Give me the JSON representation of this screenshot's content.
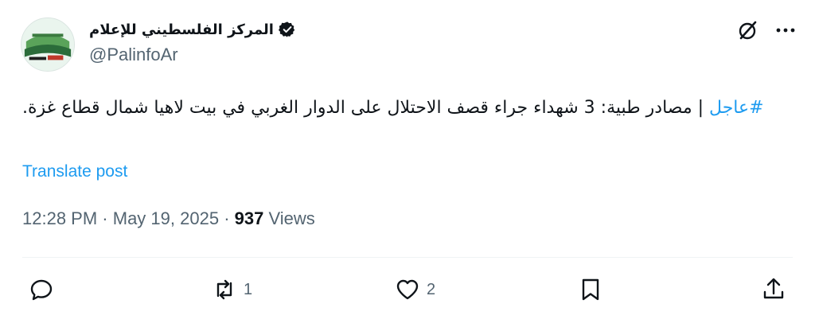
{
  "author": {
    "display_name": "المركز الفلسطيني للإعلام",
    "handle": "@PalinfoAr",
    "verified": true
  },
  "post": {
    "hashtag": "#عاجل",
    "text": " | مصادر طبية: 3 شهداء جراء قصف الاحتلال على الدوار الغربي في بيت لاهيا شمال قطاع غزة."
  },
  "translate_label": "Translate post",
  "meta": {
    "time": "12:28 PM",
    "separator": "·",
    "date": "May 19, 2025",
    "views_count": "937",
    "views_label": "Views"
  },
  "actions": {
    "reply_count": "",
    "repost_count": "1",
    "like_count": "2"
  },
  "icons": {
    "top": [
      "grok-icon",
      "more-icon"
    ],
    "bottom": [
      "reply-icon",
      "repost-icon",
      "like-icon",
      "bookmark-icon",
      "share-icon"
    ]
  },
  "colors": {
    "accent": "#1d9bf0",
    "secondary_text": "#536471",
    "primary_text": "#0f1419"
  }
}
